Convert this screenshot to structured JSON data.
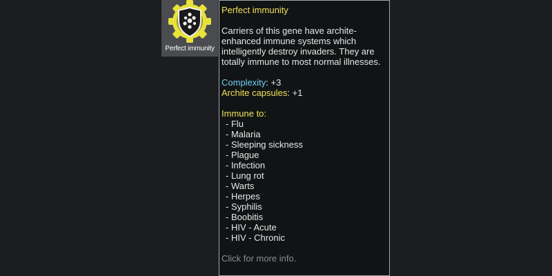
{
  "gene": {
    "label": "Perfect immunity",
    "icon": "archite-shield-icon",
    "colors": {
      "card_bg": "#4a4c50",
      "gear_yellow": "#e8e23a",
      "shield_dark": "#1a1a1a"
    }
  },
  "tooltip": {
    "title": "Perfect immunity",
    "description": "Carriers of this gene have archite-enhanced immune systems which intelligently destroy invaders. They are totally immune to most normal illnesses.",
    "stats": {
      "complexity_label": "Complexity",
      "complexity_value": ": +3",
      "archite_label": "Archite capsules",
      "archite_value": ": +1"
    },
    "immune_header": "Immune to:",
    "immune_list": [
      "- Flu",
      "- Malaria",
      "- Sleeping sickness",
      "- Plague",
      "- Infection",
      "- Lung rot",
      "- Warts",
      "- Herpes",
      "- Syphilis",
      "- Boobitis",
      "- HIV - Acute",
      "- HIV - Chronic"
    ],
    "footer": "Click for more info.",
    "colors": {
      "title": "#f2e05c",
      "complexity": "#6fd0ef",
      "footer": "#8b8d90",
      "border": "#a6a9ac",
      "background": "#111415"
    }
  }
}
